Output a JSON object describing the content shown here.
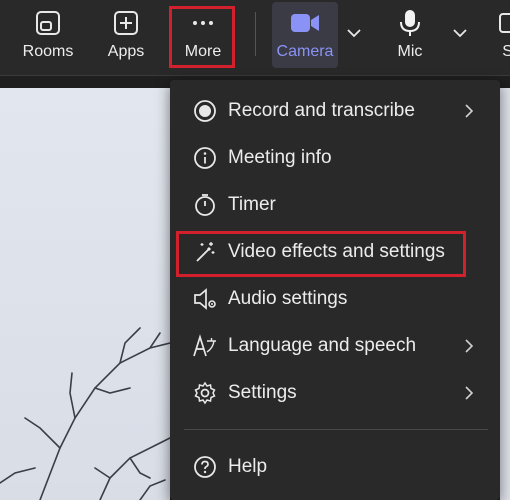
{
  "toolbar": {
    "rooms_label": "Rooms",
    "apps_label": "Apps",
    "more_label": "More",
    "camera_label": "Camera",
    "mic_label": "Mic",
    "share_label": "Sh",
    "accent_color": "#8a93f5",
    "highlight_color": "#d3202d"
  },
  "menu": {
    "items": [
      {
        "label": "Record and transcribe",
        "icon": "record-icon",
        "has_submenu": true
      },
      {
        "label": "Meeting info",
        "icon": "info-icon",
        "has_submenu": false
      },
      {
        "label": "Timer",
        "icon": "timer-icon",
        "has_submenu": false
      },
      {
        "label": "Video effects and settings",
        "icon": "magic-wand-icon",
        "has_submenu": false
      },
      {
        "label": "Audio settings",
        "icon": "speaker-settings-icon",
        "has_submenu": false
      },
      {
        "label": "Language and speech",
        "icon": "language-icon",
        "has_submenu": true
      },
      {
        "label": "Settings",
        "icon": "gear-icon",
        "has_submenu": true
      },
      {
        "label": "Help",
        "icon": "help-icon",
        "has_submenu": false
      }
    ]
  }
}
